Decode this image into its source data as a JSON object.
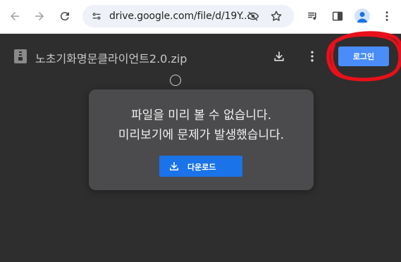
{
  "browser": {
    "url": "drive.google.com/file/d/19Y...",
    "icons": [
      "back-icon",
      "forward-icon",
      "reload-icon",
      "site-info-icon",
      "eye-off-icon",
      "bookmark-star-icon",
      "media-controls-icon",
      "side-panel-icon",
      "profile-icon",
      "more-vert-icon"
    ]
  },
  "drive": {
    "file_name": "노초기화명문클라이언트2.0.zip",
    "login_label": "로그인",
    "dialog": {
      "line1": "파일을 미리 볼 수 없습니다.",
      "line2": "미리보기에 문제가 발생했습니다.",
      "download_label": "다운로드"
    }
  },
  "colors": {
    "page_bg": "#2e2e2e",
    "dialog_bg": "#4b4a4c",
    "login_button": "#4a8df8",
    "download_button": "#1a73e8",
    "annotation_circle": "#e8101a"
  }
}
